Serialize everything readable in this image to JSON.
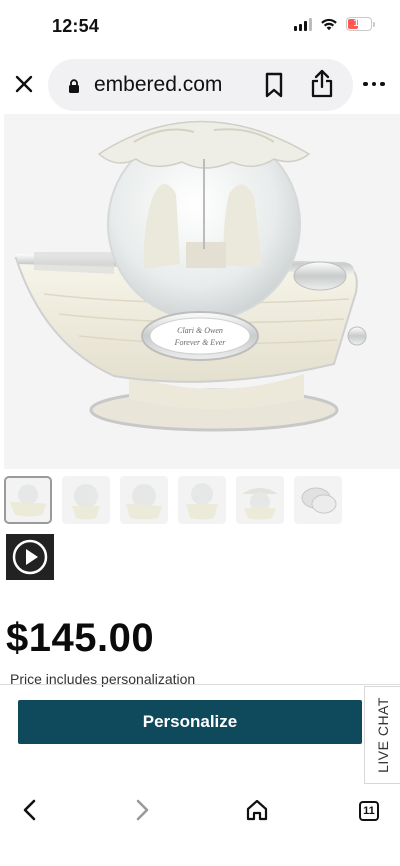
{
  "status_bar": {
    "time": "12:54",
    "battery": "17",
    "battery_level_percent": 17,
    "battery_color": "#ff5a52"
  },
  "browser": {
    "url_display": "embered.com"
  },
  "product": {
    "image_icon": "snow-globe-boat-photo",
    "price": "$145.00",
    "price_note": "Price includes personalization",
    "plaque_text_line1": "Clari & Owen",
    "plaque_text_line2": "Forever & Ever"
  },
  "actions": {
    "personalize_label": "Personalize",
    "live_chat_label": "LIVE CHAT",
    "accent_color": "#0f4a5c"
  },
  "toolbar": {
    "tab_count": "11"
  }
}
